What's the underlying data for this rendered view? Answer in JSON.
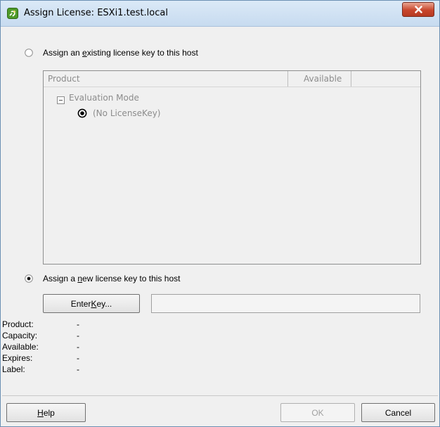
{
  "window": {
    "title": "Assign License: ESXi1.test.local",
    "close_glyph": "X"
  },
  "options": {
    "existing_prefix": "Assign an ",
    "existing_accel": "e",
    "existing_suffix": "xisting license key to this host",
    "existing_selected": false,
    "new_prefix": "Assign a ",
    "new_accel": "n",
    "new_suffix": "ew license key to this host",
    "new_selected": true
  },
  "license_list": {
    "columns": [
      "Product",
      "Available"
    ],
    "group_label": "Evaluation Mode",
    "group_expander": "-",
    "item_label": "(No LicenseKey)",
    "item_selected": true
  },
  "enter_key_button": {
    "prefix": "Enter ",
    "accel": "K",
    "suffix": "ey..."
  },
  "key_field_value": "",
  "details": [
    {
      "label": "Product:",
      "value": "-"
    },
    {
      "label": "Capacity:",
      "value": "-"
    },
    {
      "label": "Available:",
      "value": "-"
    },
    {
      "label": "Expires:",
      "value": "-"
    },
    {
      "label": "Label:",
      "value": "-"
    }
  ],
  "footer": {
    "help_accel": "H",
    "help_suffix": "elp",
    "ok_label": "OK",
    "ok_enabled": false,
    "cancel_label": "Cancel"
  }
}
